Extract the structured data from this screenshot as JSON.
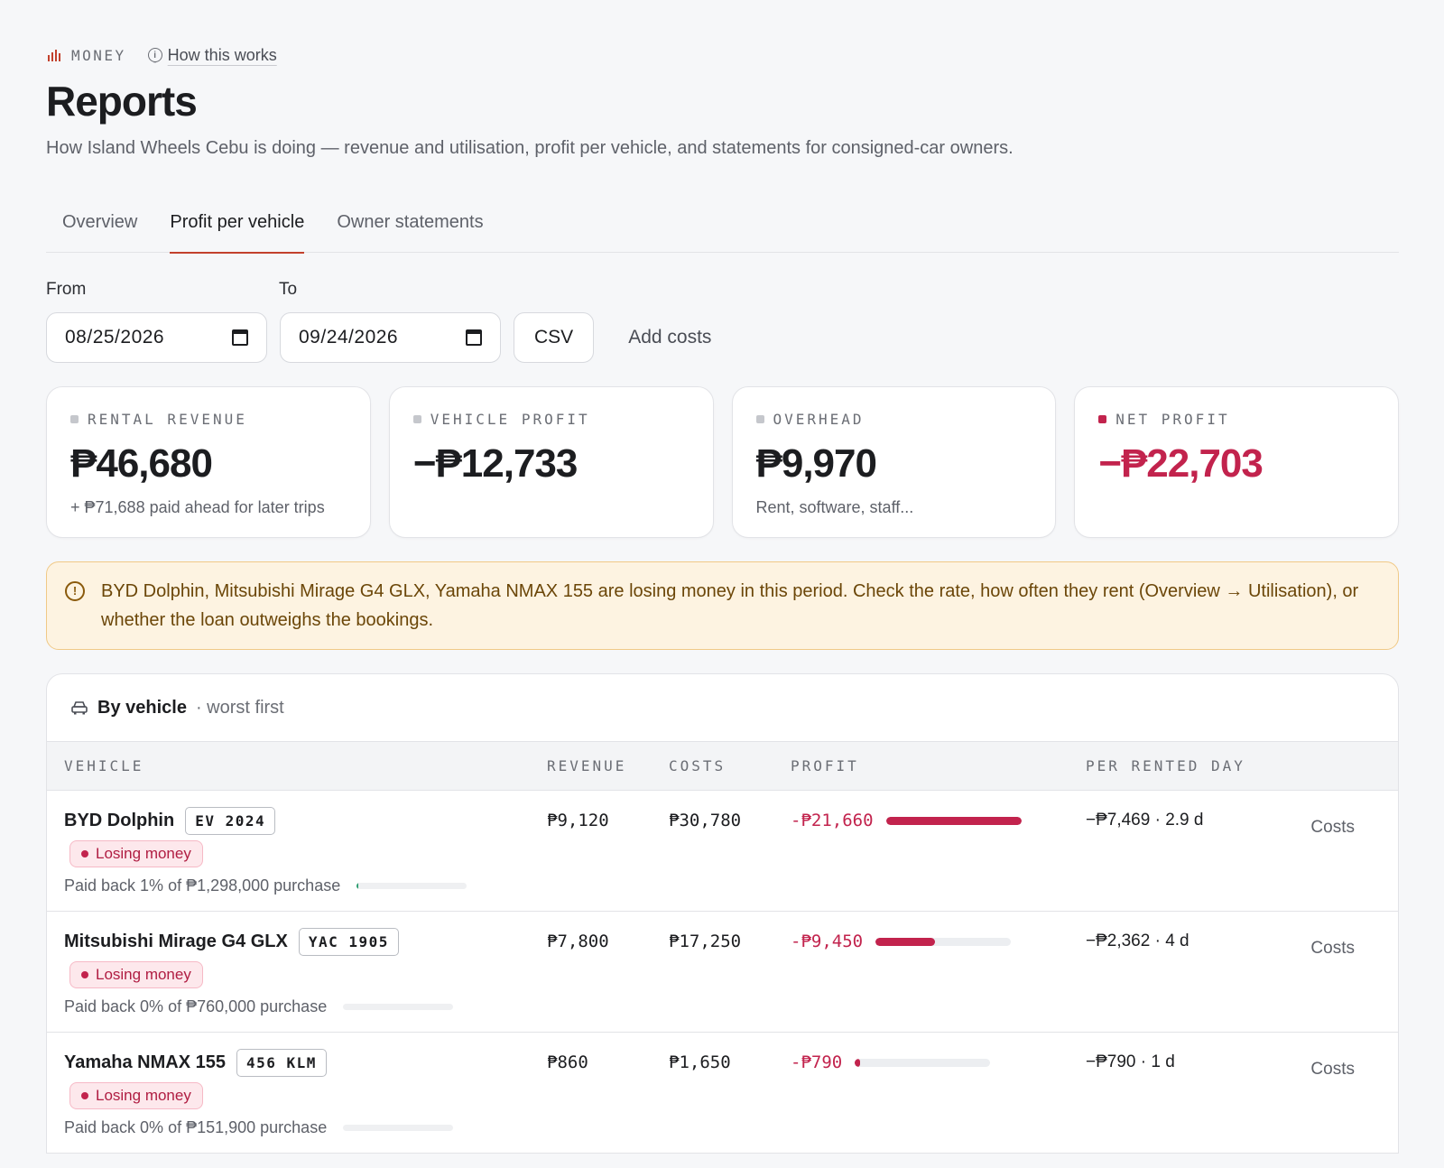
{
  "breadcrumb": {
    "section": "MONEY",
    "help": "How this works"
  },
  "page": {
    "title": "Reports",
    "subtitle": "How Island Wheels Cebu is doing — revenue and utilisation, profit per vehicle, and statements for consigned-car owners."
  },
  "tabs": [
    {
      "label": "Overview",
      "active": false
    },
    {
      "label": "Profit per vehicle",
      "active": true
    },
    {
      "label": "Owner statements",
      "active": false
    }
  ],
  "filters": {
    "from_label": "From",
    "to_label": "To",
    "from_value": "08/25/2026",
    "to_value": "09/24/2026",
    "csv_label": "CSV",
    "add_costs_label": "Add costs"
  },
  "cards": [
    {
      "label": "RENTAL REVENUE",
      "value": "₱46,680",
      "note": "+ ₱71,688 paid ahead for later trips",
      "negative": false
    },
    {
      "label": "VEHICLE PROFIT",
      "value": "−₱12,733",
      "note": "",
      "negative": false
    },
    {
      "label": "OVERHEAD",
      "value": "₱9,970",
      "note": "Rent, software, staff...",
      "negative": false
    },
    {
      "label": "NET PROFIT",
      "value": "−₱22,703",
      "note": "",
      "negative": true
    }
  ],
  "alert": {
    "text": "BYD Dolphin, Mitsubishi Mirage G4 GLX, Yamaha NMAX 155 are losing money in this period. Check the rate, how often they rent (Overview → Utilisation), or whether the loan outweighs the bookings."
  },
  "table": {
    "title": "By vehicle",
    "subtitle": "· worst first",
    "headers": {
      "vehicle": "VEHICLE",
      "revenue": "REVENUE",
      "costs": "COSTS",
      "profit": "PROFIT",
      "per_day": "PER RENTED DAY"
    },
    "rows": [
      {
        "name": "BYD Dolphin",
        "plate": "EV 2024",
        "badge": "Losing money",
        "payback": "Paid back 1% of ₱1,298,000 purchase",
        "payback_fraction": 0.01,
        "revenue": "₱9,120",
        "costs": "₱30,780",
        "profit": "-₱21,660",
        "profit_bar_fraction": 1.0,
        "per_day": "−₱7,469 · 2.9 d",
        "action": "Costs"
      },
      {
        "name": "Mitsubishi Mirage G4 GLX",
        "plate": "YAC 1905",
        "badge": "Losing money",
        "payback": "Paid back 0% of ₱760,000 purchase",
        "payback_fraction": 0.0,
        "revenue": "₱7,800",
        "costs": "₱17,250",
        "profit": "-₱9,450",
        "profit_bar_fraction": 0.44,
        "per_day": "−₱2,362 · 4 d",
        "action": "Costs"
      },
      {
        "name": "Yamaha NMAX 155",
        "plate": "456 KLM",
        "badge": "Losing money",
        "payback": "Paid back 0% of ₱151,900 purchase",
        "payback_fraction": 0.0,
        "revenue": "₱860",
        "costs": "₱1,650",
        "profit": "-₱790",
        "profit_bar_fraction": 0.04,
        "per_day": "−₱790 · 1 d",
        "action": "Costs"
      }
    ]
  }
}
